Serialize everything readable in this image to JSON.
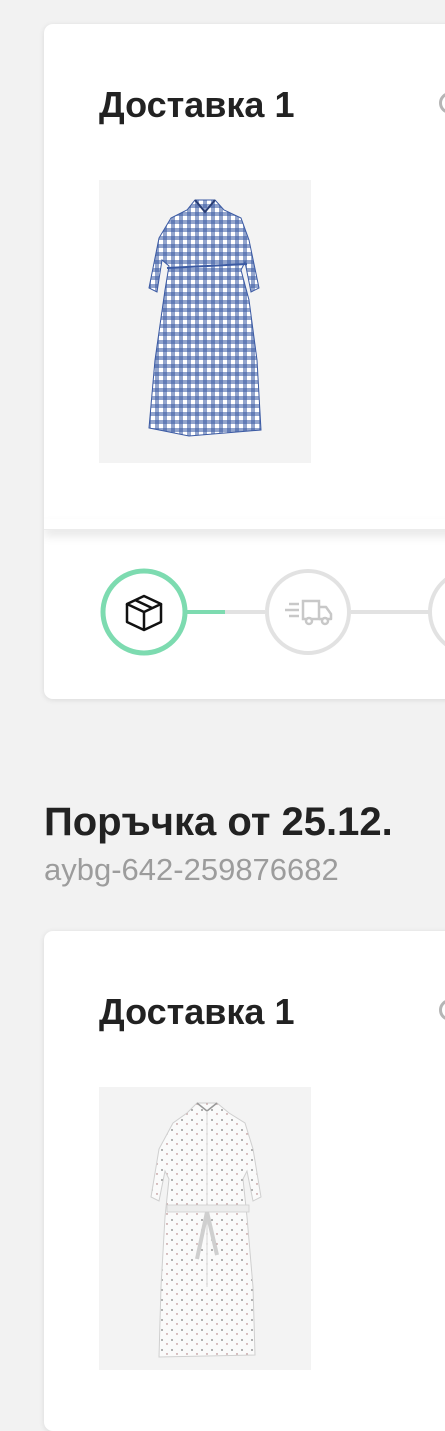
{
  "orders": [
    {
      "delivery_label": "Доставка 1",
      "product_image": "blue-gingham-midi-dress",
      "tracking_steps": [
        {
          "icon": "package-icon",
          "status": "active"
        },
        {
          "icon": "delivery-truck-icon",
          "status": "inactive"
        },
        {
          "icon": "step-icon",
          "status": "inactive"
        }
      ]
    },
    {
      "heading": "Поръчка от 25.12.",
      "number": "aybg-642-259876682",
      "delivery_label": "Доставка 1",
      "product_image": "white-floral-belted-dress"
    }
  ],
  "colors": {
    "active_step": "#7ddbb0",
    "inactive_step": "#e2e2e2",
    "gingham_blue": "#3b5aa3"
  }
}
